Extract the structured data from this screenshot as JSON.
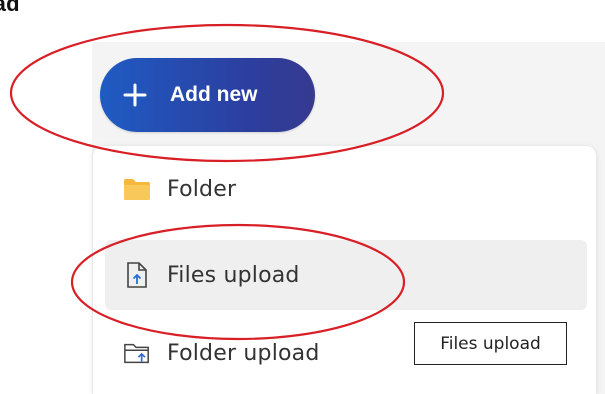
{
  "heading": "oad",
  "add_button": {
    "label": "Add new",
    "icon": "plus-icon"
  },
  "menu": {
    "items": [
      {
        "label": "Folder",
        "icon": "folder-icon"
      },
      {
        "label": "Files upload",
        "icon": "file-upload-icon"
      },
      {
        "label": "Folder upload",
        "icon": "folder-upload-icon"
      }
    ]
  },
  "tooltip": {
    "text": "Files upload"
  },
  "colors": {
    "annotation": "#d81f26",
    "accent": "#2a4fb4",
    "folder": "#f5b83d"
  }
}
